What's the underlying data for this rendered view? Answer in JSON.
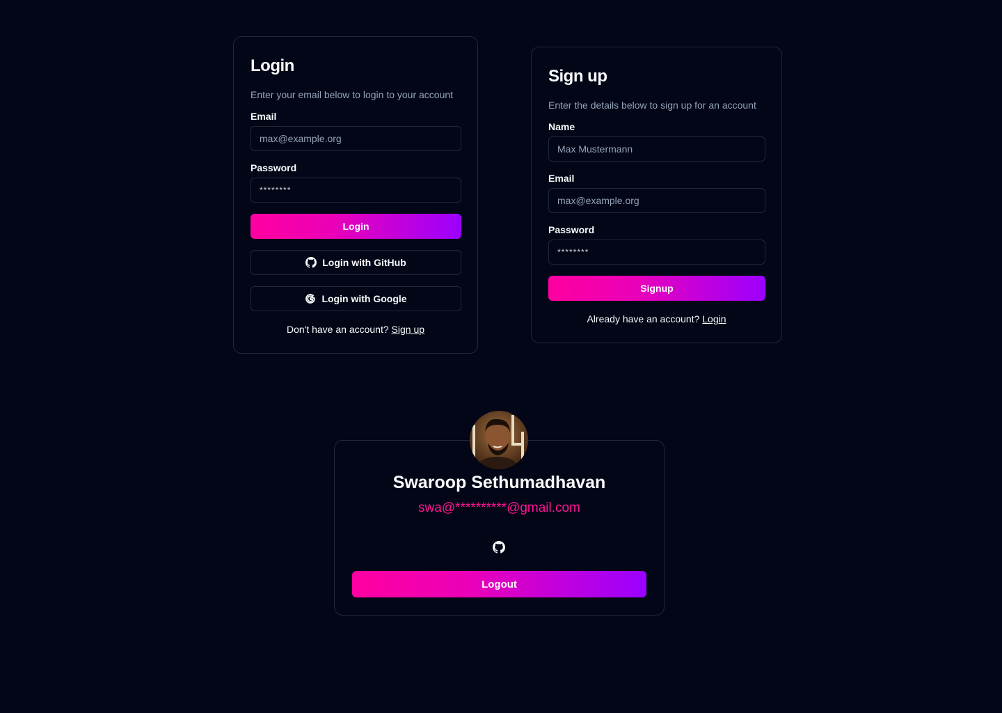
{
  "login": {
    "title": "Login",
    "subtitle": "Enter your email below to login to your account",
    "email_label": "Email",
    "email_placeholder": "max@example.org",
    "password_label": "Password",
    "password_value": "********",
    "login_button": "Login",
    "github_button": "Login with GitHub",
    "google_button": "Login with Google",
    "footer_text": "Don't have an account?",
    "footer_link": "Sign up"
  },
  "signup": {
    "title": "Sign up",
    "subtitle": "Enter the details below to sign up for an account",
    "name_label": "Name",
    "name_placeholder": "Max Mustermann",
    "email_label": "Email",
    "email_placeholder": "max@example.org",
    "password_label": "Password",
    "password_value": "********",
    "signup_button": "Signup",
    "footer_text": "Already have an account?",
    "footer_link": "Login"
  },
  "profile": {
    "name": "Swaroop Sethumadhavan",
    "email": "swa@**********@gmail.com",
    "provider_icon": "github-icon",
    "logout_button": "Logout"
  },
  "colors": {
    "background": "#030617",
    "border": "#1e293b",
    "accent_start": "#ff00a0",
    "accent_end": "#9b00ff",
    "email_accent": "#ff1493"
  }
}
